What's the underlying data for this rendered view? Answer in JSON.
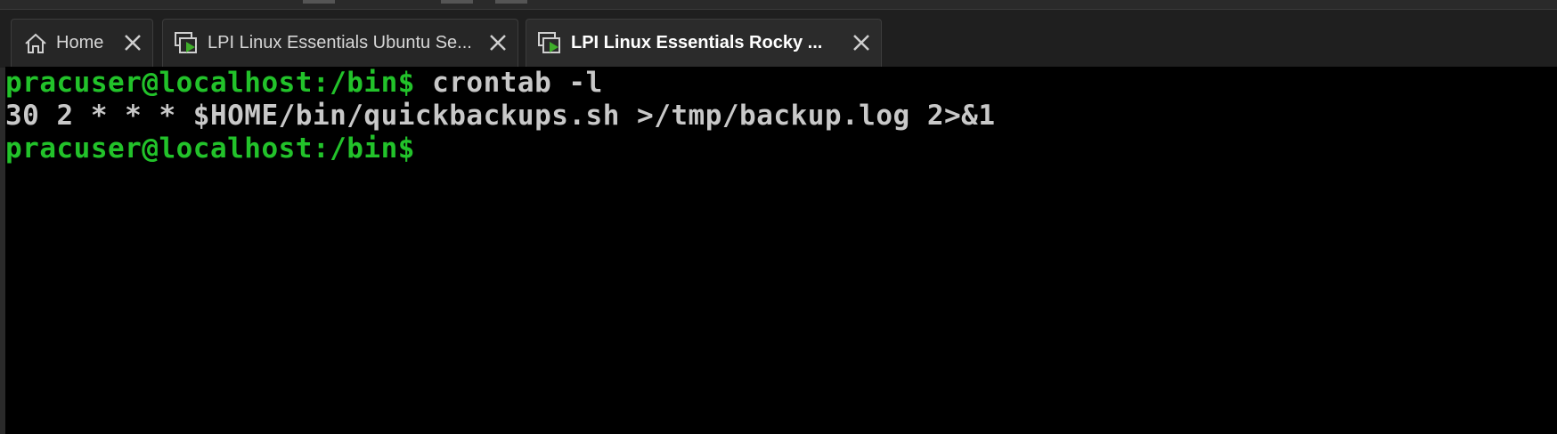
{
  "tabs": [
    {
      "label": "Home",
      "icon": "home-icon",
      "active": false
    },
    {
      "label": "LPI Linux Essentials Ubuntu Se...",
      "icon": "vm-console-icon",
      "active": false
    },
    {
      "label": "LPI Linux Essentials Rocky ...",
      "icon": "vm-console-icon",
      "active": true
    }
  ],
  "terminal": {
    "lines": [
      {
        "prompt": "pracuser@localhost:/bin$",
        "text": " crontab -l"
      },
      {
        "prompt": "",
        "text": "30 2 * * * $HOME/bin/quickbackups.sh >/tmp/backup.log 2>&1"
      },
      {
        "prompt": "pracuser@localhost:/bin$",
        "text": ""
      }
    ]
  },
  "colors": {
    "prompt": "#22c22a",
    "terminal_bg": "#000000",
    "text": "#c8c8c8",
    "vm_icon_accent": "#3fae2a"
  }
}
